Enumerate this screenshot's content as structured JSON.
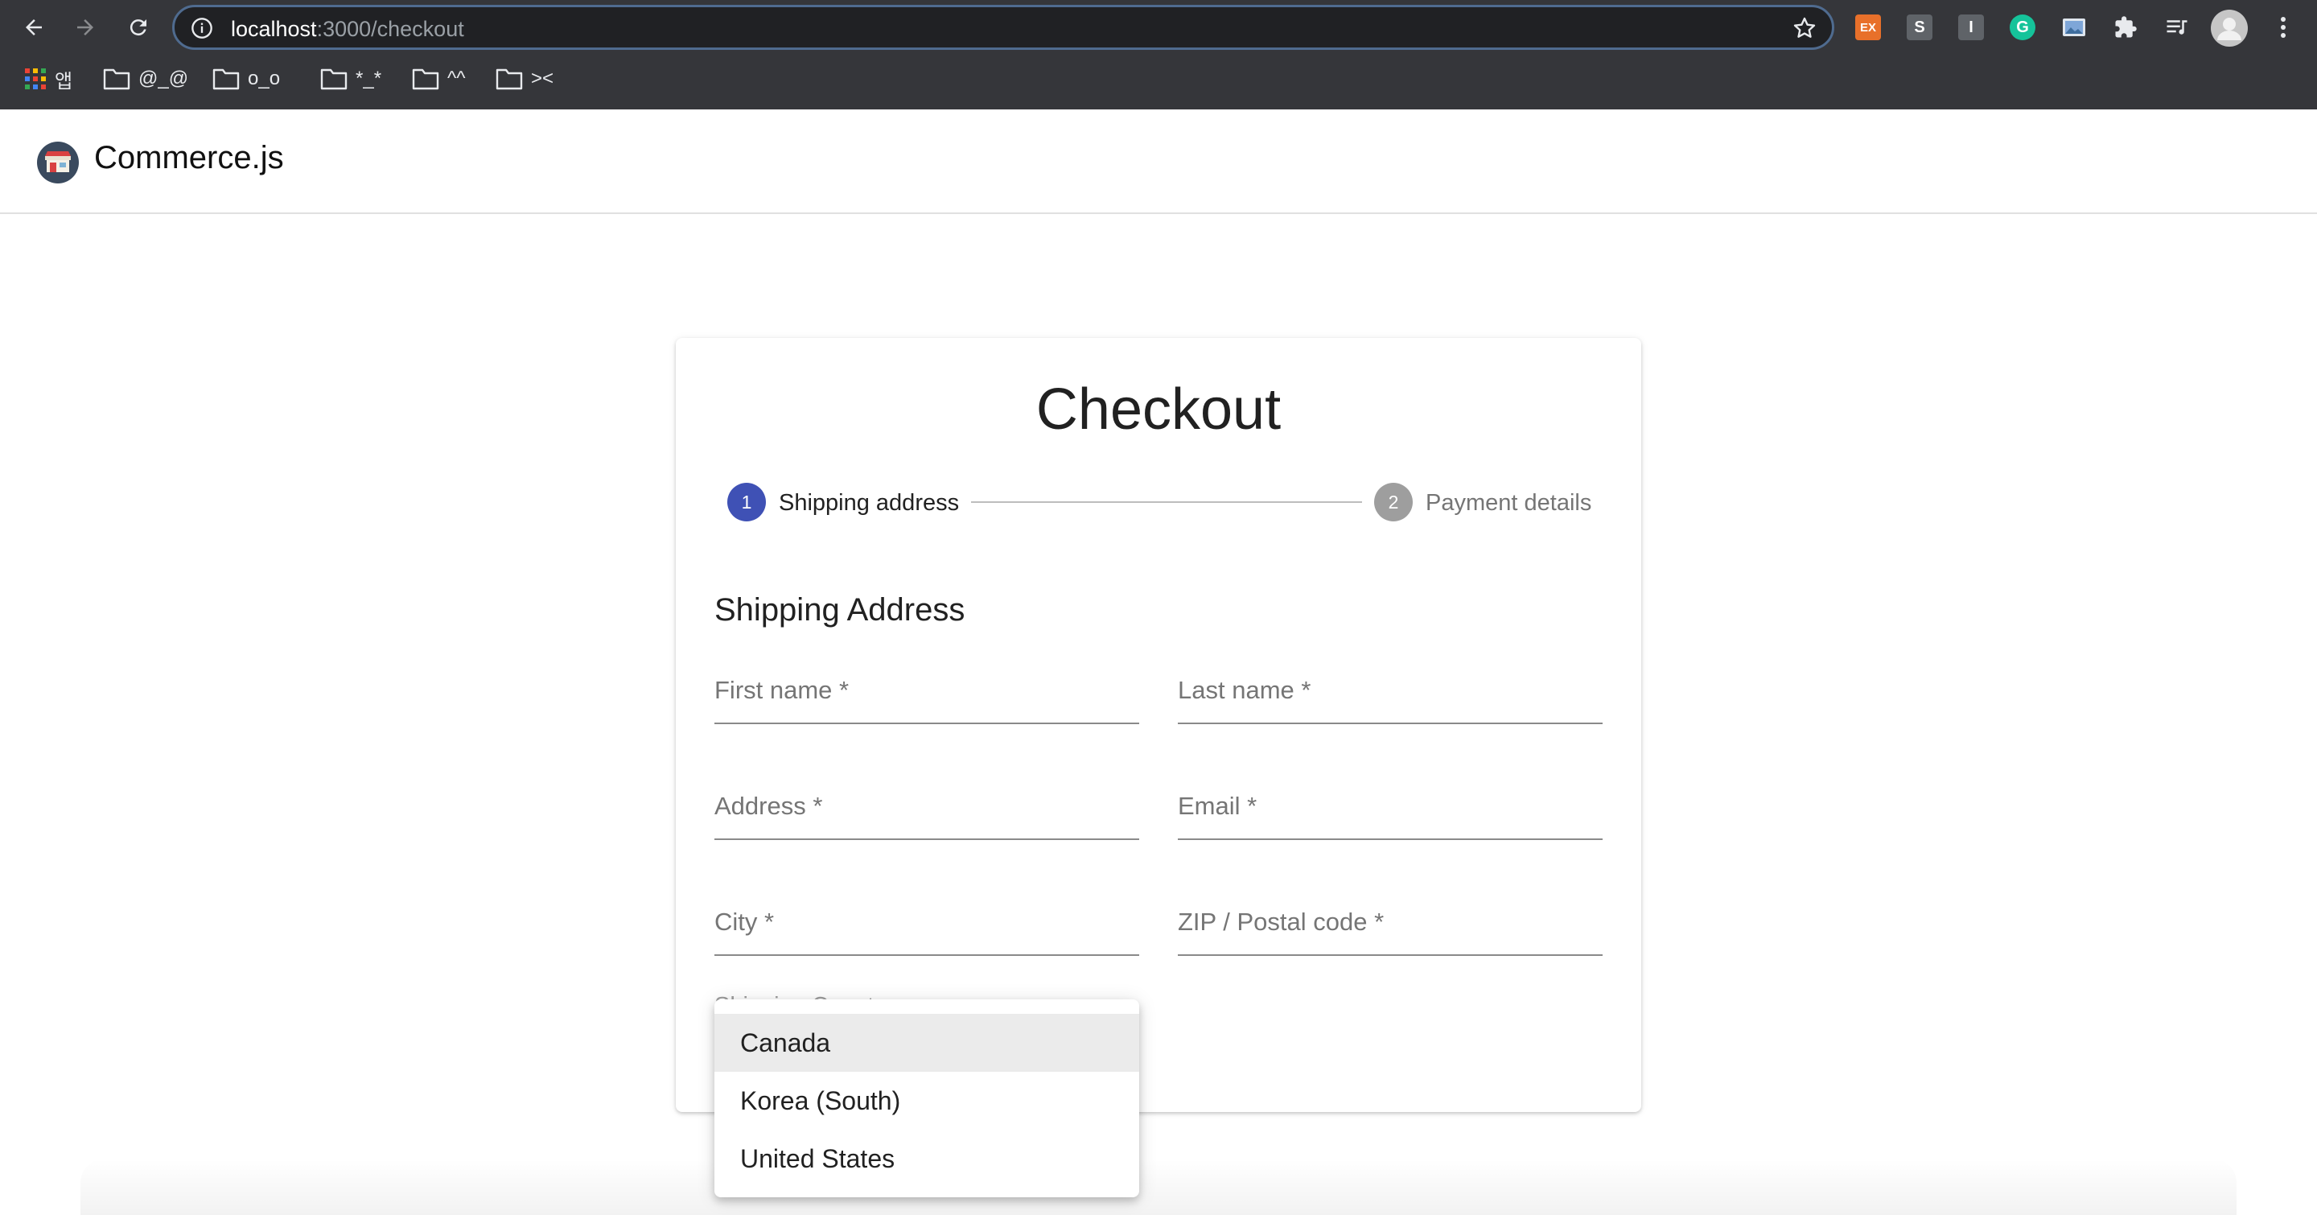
{
  "browser": {
    "url_host": "localhost",
    "url_path": ":3000/checkout",
    "bookmarks": [
      {
        "label": "앱"
      },
      {
        "label": "@_@"
      },
      {
        "label": "o_o"
      },
      {
        "label": "*_*"
      },
      {
        "label": "^^"
      },
      {
        "label": "><"
      }
    ],
    "extensions": [
      {
        "label": "EX",
        "color": "#e8702a"
      },
      {
        "label": "S",
        "color": "#5f6368"
      },
      {
        "label": "I",
        "color": "#5f6368"
      },
      {
        "label": "G",
        "color": "#15c39a"
      }
    ]
  },
  "appbar": {
    "brand": "Commerce.js"
  },
  "checkout": {
    "title": "Checkout",
    "steps": [
      {
        "number": "1",
        "label": "Shipping address",
        "color": "#3f51b5"
      },
      {
        "number": "2",
        "label": "Payment details",
        "color": "#9e9e9e"
      }
    ],
    "section_title": "Shipping Address",
    "fields": [
      {
        "label": "First name",
        "required": "*"
      },
      {
        "label": "Last name",
        "required": "*"
      },
      {
        "label": "Address",
        "required": "*"
      },
      {
        "label": "Email",
        "required": "*"
      },
      {
        "label": "City",
        "required": "*"
      },
      {
        "label": "ZIP / Postal code",
        "required": "*"
      }
    ],
    "country_select": {
      "label": "Shipping Country",
      "options": [
        "Canada",
        "Korea (South)",
        "United States"
      ],
      "highlighted": "Canada"
    }
  }
}
